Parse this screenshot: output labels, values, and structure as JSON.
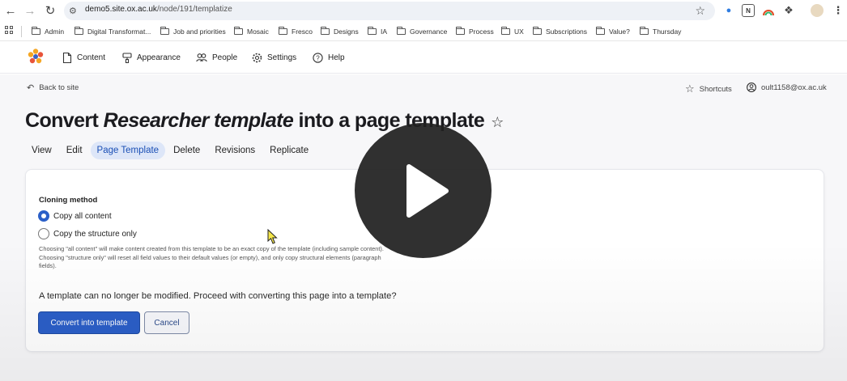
{
  "browser": {
    "url_host": "demo5.site.ox.ac.uk",
    "url_path": "/node/191/templatize",
    "bookmarks": [
      "Admin",
      "Digital Transformat...",
      "Job and priorities",
      "Mosaic",
      "Fresco",
      "Designs",
      "IA",
      "Governance",
      "Process",
      "UX",
      "Subscriptions",
      "Value?",
      "Thursday"
    ]
  },
  "toolbar": {
    "items": [
      "Content",
      "Appearance",
      "People",
      "Settings",
      "Help"
    ]
  },
  "header": {
    "back_label": "Back to site",
    "shortcuts_label": "Shortcuts",
    "account_label": "oult1158@ox.ac.uk"
  },
  "title": {
    "prefix": "Convert ",
    "italic": "Researcher template",
    "suffix": " into a page template"
  },
  "tabs": [
    {
      "label": "View",
      "active": false
    },
    {
      "label": "Edit",
      "active": false
    },
    {
      "label": "Page Template",
      "active": true
    },
    {
      "label": "Delete",
      "active": false
    },
    {
      "label": "Revisions",
      "active": false
    },
    {
      "label": "Replicate",
      "active": false
    }
  ],
  "form": {
    "cloning_label": "Cloning method",
    "options": [
      {
        "label": "Copy all content",
        "checked": true
      },
      {
        "label": "Copy the structure only",
        "checked": false
      }
    ],
    "description": "Choosing \"all content\" will make content created from this template to be an exact copy of the template (including sample content). Choosing \"structure only\" will reset all field values to their default values (or empty), and only copy structural elements (paragraph fields).",
    "confirm_text": "A template can no longer be modified. Proceed with converting this page into a template?",
    "submit_label": "Convert into template",
    "cancel_label": "Cancel"
  },
  "colors": {
    "primary": "#2b5fc8",
    "tab_active_bg": "#dde6f8",
    "play_overlay": "#202020"
  }
}
